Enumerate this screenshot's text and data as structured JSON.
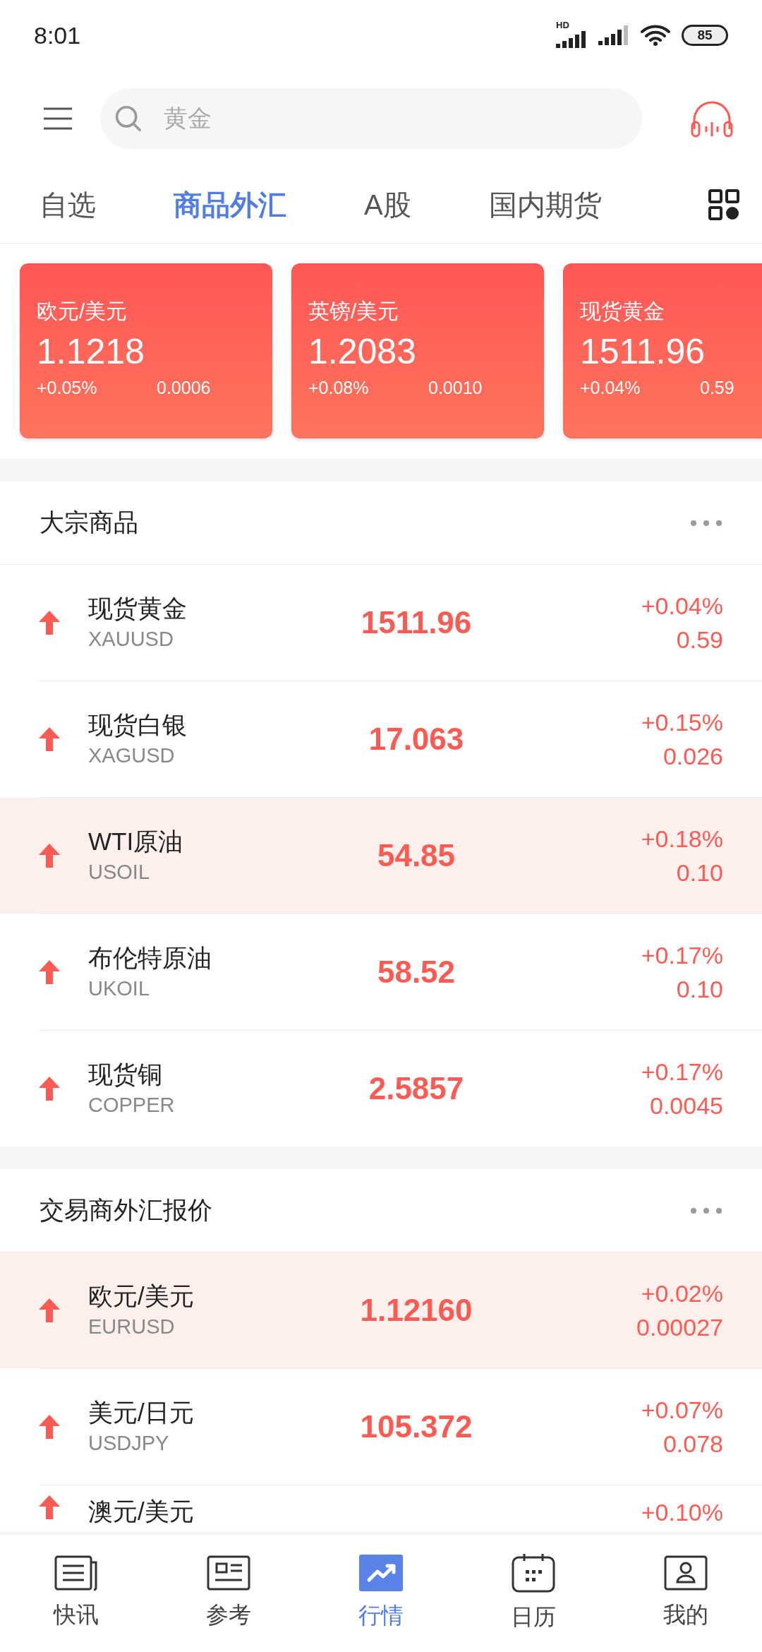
{
  "status_bar": {
    "time": "8:01",
    "battery": "85",
    "network_badge": "HD"
  },
  "search": {
    "placeholder": "黄金"
  },
  "tabs": [
    {
      "label": "自选",
      "selected": false
    },
    {
      "label": "商品外汇",
      "selected": true
    },
    {
      "label": "A股",
      "selected": false
    },
    {
      "label": "国内期货",
      "selected": false
    }
  ],
  "cards": [
    {
      "name": "欧元/美元",
      "price": "1.1218",
      "change_pct": "+0.05%",
      "change": "0.0006"
    },
    {
      "name": "英镑/美元",
      "price": "1.2083",
      "change_pct": "+0.08%",
      "change": "0.0010"
    },
    {
      "name": "现货黄金",
      "price": "1511.96",
      "change_pct": "+0.04%",
      "change": "0.59"
    }
  ],
  "sections": [
    {
      "title": "大宗商品",
      "rows": [
        {
          "name": "现货黄金",
          "code": "XAUUSD",
          "price": "1511.96",
          "change_pct": "+0.04%",
          "change": "0.59",
          "highlighted": false
        },
        {
          "name": "现货白银",
          "code": "XAGUSD",
          "price": "17.063",
          "change_pct": "+0.15%",
          "change": "0.026",
          "highlighted": false
        },
        {
          "name": "WTI原油",
          "code": "USOIL",
          "price": "54.85",
          "change_pct": "+0.18%",
          "change": "0.10",
          "highlighted": true
        },
        {
          "name": "布伦特原油",
          "code": "UKOIL",
          "price": "58.52",
          "change_pct": "+0.17%",
          "change": "0.10",
          "highlighted": false
        },
        {
          "name": "现货铜",
          "code": "COPPER",
          "price": "2.5857",
          "change_pct": "+0.17%",
          "change": "0.0045",
          "highlighted": false
        }
      ]
    },
    {
      "title": "交易商外汇报价",
      "rows": [
        {
          "name": "欧元/美元",
          "code": "EURUSD",
          "price": "1.12160",
          "change_pct": "+0.02%",
          "change": "0.00027",
          "highlighted": true
        },
        {
          "name": "美元/日元",
          "code": "USDJPY",
          "price": "105.372",
          "change_pct": "+0.07%",
          "change": "0.078",
          "highlighted": false
        },
        {
          "name": "澳元/美元",
          "change_pct": "+0.10%",
          "highlighted": false
        }
      ]
    }
  ],
  "bottom_nav": [
    {
      "label": "快讯",
      "kind": "news",
      "selected": false
    },
    {
      "label": "参考",
      "kind": "reference",
      "selected": false
    },
    {
      "label": "行情",
      "kind": "market",
      "selected": true
    },
    {
      "label": "日历",
      "kind": "calendar",
      "selected": false
    },
    {
      "label": "我的",
      "kind": "profile",
      "selected": false
    }
  ]
}
